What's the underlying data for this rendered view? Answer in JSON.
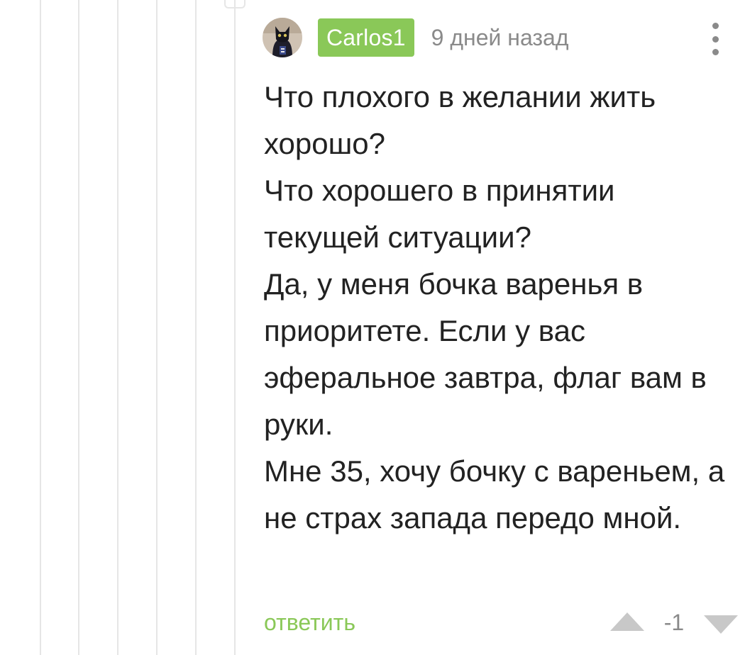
{
  "comment": {
    "author": "Carlos1",
    "time": "9 дней назад",
    "avatar_icon": "cat-avatar-icon",
    "more_icon": "vertical-dots-icon",
    "paragraphs": [
      "Что плохого в желании жить хорошо?",
      "Что хорошего в принятии текущей ситуации?",
      "Да, у меня бочка варенья в приоритете. Если у вас эферальное завтра, флаг вам в руки.",
      "Мне 35, хочу бочку с вареньем, а не страх запада передо мной."
    ],
    "reply_label": "ответить",
    "rating": "-1",
    "upvote_icon": "triangle-up-icon",
    "downvote_icon": "triangle-down-icon"
  },
  "colors": {
    "accent_green": "#8ac858",
    "muted_gray": "#8a8a8a",
    "text": "#222222",
    "thread_line": "#e6e6e6",
    "vote_arrow": "#c8c8c8"
  }
}
